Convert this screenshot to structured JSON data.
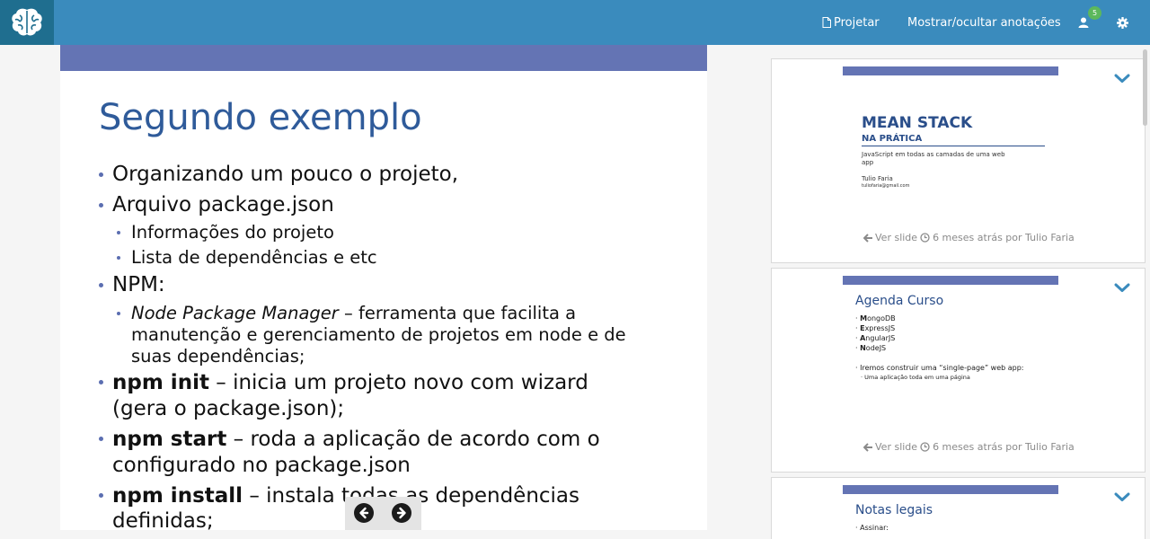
{
  "header": {
    "projetar_label": "Projetar",
    "toggle_annotations_label": "Mostrar/ocultar anotações",
    "user_badge_count": "5",
    "icons": [
      "brain-logo-icon",
      "file-icon",
      "user-icon",
      "gear-icon"
    ]
  },
  "slide": {
    "title": "Segundo exemplo",
    "bullets": [
      {
        "text": "Organizando um pouco o projeto,"
      },
      {
        "text": "Arquivo package.json"
      },
      {
        "text": "Informações do projeto"
      },
      {
        "text": "Lista de dependências e etc"
      },
      {
        "text": "NPM:"
      },
      {
        "em": "Node Package Manager",
        "rest": " – ferramenta que facilita a",
        "line2": "manutenção e gerenciamento de projetos em node e de",
        "line3": "suas dependências;"
      },
      {
        "bold": "npm init",
        "rest": " – inicia um projeto novo com wizard",
        "line2": "(gera o package.json);"
      },
      {
        "bold": "npm start",
        "rest": " – roda a aplicação de acordo com o",
        "line2": "configurado no package.json"
      },
      {
        "bold": "npm install",
        "rest": " – instala todas as dependências",
        "line2": "definidas;"
      }
    ],
    "nav_icons": [
      "prev-slide-icon",
      "next-slide-icon"
    ]
  },
  "sidebar": {
    "cards": [
      {
        "thumb": {
          "title": "MEAN STACK",
          "subtitle": "NA PRÁTICA",
          "description": "JavaScript em todas as camadas de uma web app",
          "author": "Tulio Faria",
          "email": "tuliofaria@gmail.com"
        },
        "view_label": "Ver slide",
        "time_label": "6 meses atrás por Tulio Faria"
      },
      {
        "thumb": {
          "title": "Agenda Curso",
          "items": [
            {
              "first": "M",
              "rest": "ongoDB"
            },
            {
              "first": "E",
              "rest": "xpressJS"
            },
            {
              "first": "A",
              "rest": "ngularJS"
            },
            {
              "first": "N",
              "rest": "odeJS"
            }
          ],
          "point": "Iremos construir uma “single-page” web app:",
          "subpoint": "Uma aplicação toda em uma página"
        },
        "view_label": "Ver slide",
        "time_label": "6 meses atrás por Tulio Faria"
      },
      {
        "thumb": {
          "title": "Notas legais",
          "item": "Assinar:"
        }
      }
    ]
  },
  "colors": {
    "topbar": "#3a8bbd",
    "logo_bg": "#1f6e8f",
    "slide_band": "#6474b4",
    "slide_title": "#2f5b9a",
    "badge": "#5cb85c",
    "chevron": "#3a8bbd"
  }
}
